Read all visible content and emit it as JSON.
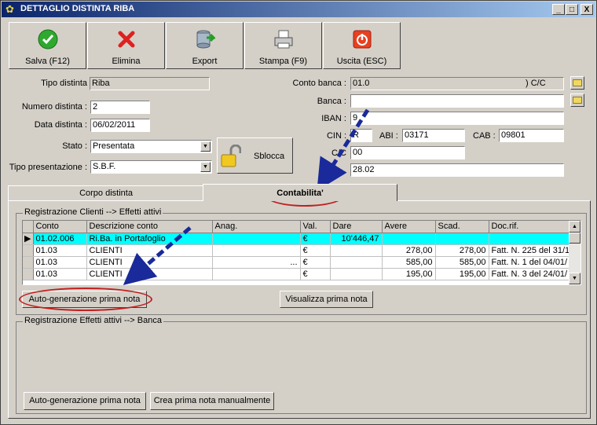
{
  "window": {
    "title": "DETTAGLIO DISTINTA RIBA",
    "controls": {
      "minimize": "_",
      "maximize": "□",
      "close": "X"
    }
  },
  "toolbar": {
    "save": "Salva (F12)",
    "delete": "Elimina",
    "export": "Export",
    "print": "Stampa (F9)",
    "exit": "Uscita (ESC)"
  },
  "form": {
    "tipo_distinta": {
      "label": "Tipo distinta",
      "value": "Riba"
    },
    "numero_distinta": {
      "label": "Numero distinta :",
      "value": "2"
    },
    "data_distinta": {
      "label": "Data distinta :",
      "value": "06/02/2011"
    },
    "stato": {
      "label": "Stato :",
      "value": "Presentata"
    },
    "tipo_presentazione": {
      "label": "Tipo presentazione :",
      "value": "S.B.F."
    },
    "sblocca": "Sblocca",
    "conto_banca": {
      "label": "Conto banca :",
      "value": "01.0",
      "suffix": ") C/C"
    },
    "banca": {
      "label": "Banca :",
      "value": ""
    },
    "iban": {
      "label": "IBAN :",
      "value": "9"
    },
    "cin": {
      "label": "CIN :",
      "value": "R"
    },
    "abi": {
      "label": "ABI :",
      "value": "03171"
    },
    "cab": {
      "label": "CAB :",
      "value": "09801"
    },
    "cc": {
      "label": "C/C",
      "value": "00"
    },
    "conto_extra": {
      "value": "28.02"
    }
  },
  "tabs": [
    {
      "label": "Corpo distinta",
      "active": false
    },
    {
      "label": "Contabilita'",
      "active": true
    }
  ],
  "section1": {
    "title": "Registrazione Clienti --> Effetti attivi",
    "columns": [
      "Conto",
      "Descrizione conto",
      "Anag.",
      "Val.",
      "Dare",
      "Avere",
      "Scad.",
      "Doc.rif."
    ],
    "rows": [
      {
        "conto": "01.02.006",
        "descrizione": "Ri.Ba. in Portafoglio",
        "anag": "",
        "val": "€",
        "dare": "10'446,47",
        "avere": "",
        "scad": "",
        "docrif": ""
      },
      {
        "conto": "01.03",
        "descrizione": "CLIENTI",
        "anag": "",
        "val": "€",
        "dare": "",
        "avere": "278,00",
        "scad": "278,00",
        "docrif": "Fatt. N. 225 del 31/1"
      },
      {
        "conto": "01.03",
        "descrizione": "CLIENTI",
        "anag": "...",
        "val": "€",
        "dare": "",
        "avere": "585,00",
        "scad": "585,00",
        "docrif": "Fatt. N. 1 del 04/01/"
      },
      {
        "conto": "01.03",
        "descrizione": "CLIENTI",
        "anag": "",
        "val": "€",
        "dare": "",
        "avere": "195,00",
        "scad": "195,00",
        "docrif": "Fatt. N. 3 del 24/01/"
      }
    ],
    "btn_auto": "Auto-generazione prima nota",
    "btn_view": "Visualizza prima nota"
  },
  "section2": {
    "title": "Registrazione Effetti attivi --> Banca",
    "btn_auto": "Auto-generazione prima nota",
    "btn_manual": "Crea prima nota manualmente"
  },
  "colors": {
    "title_start": "#0a246a",
    "title_end": "#a6caf0",
    "selected_row": "#00ffff",
    "annotation_oval": "#c02020",
    "annotation_arrow": "#1a2a9a"
  },
  "icons": [
    "save-icon",
    "delete-icon",
    "export-icon",
    "print-icon",
    "exit-icon",
    "padlock-icon",
    "folder-icon"
  ]
}
